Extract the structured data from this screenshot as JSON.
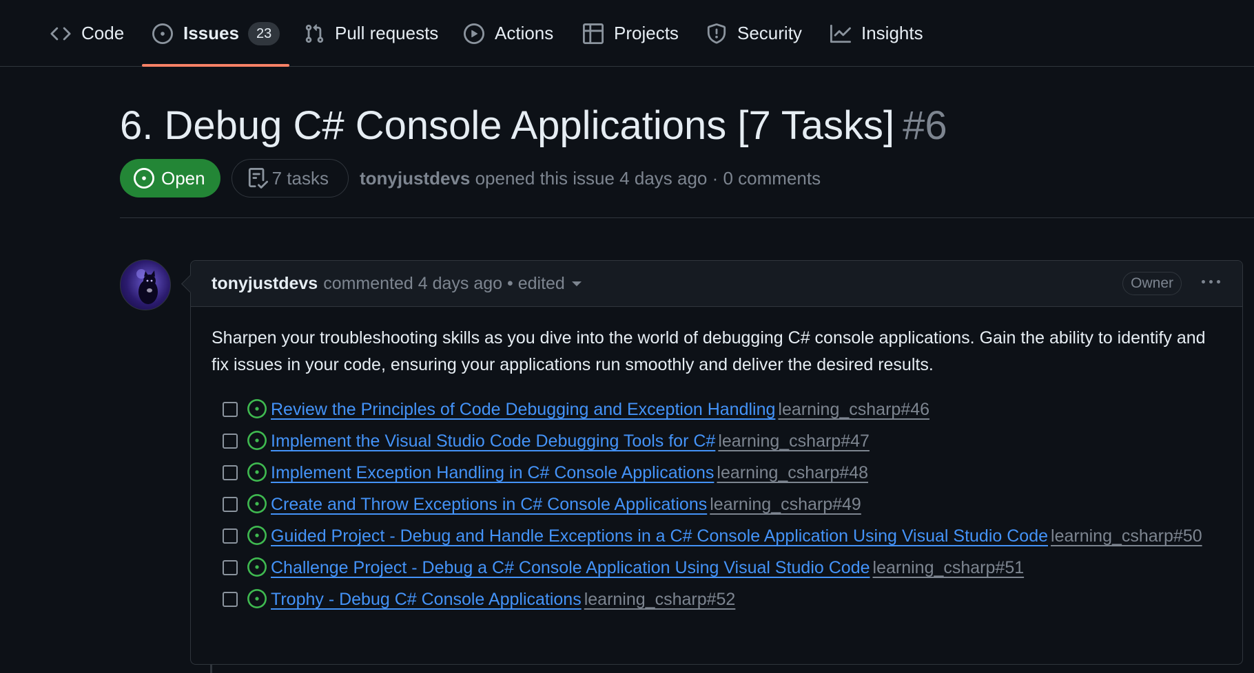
{
  "nav": {
    "tabs": [
      {
        "label": "Code",
        "icon": "code-icon"
      },
      {
        "label": "Issues",
        "icon": "issue-opened-icon",
        "count": "23",
        "selected": true
      },
      {
        "label": "Pull requests",
        "icon": "git-pull-request-icon"
      },
      {
        "label": "Actions",
        "icon": "play-icon"
      },
      {
        "label": "Projects",
        "icon": "table-icon"
      },
      {
        "label": "Security",
        "icon": "shield-icon"
      },
      {
        "label": "Insights",
        "icon": "graph-icon"
      }
    ]
  },
  "issue": {
    "title": "6. Debug C# Console Applications [7 Tasks]",
    "number": "#6",
    "state": "Open",
    "tasks_label": "7 tasks",
    "author": "tonyjustdevs",
    "opened_text": "opened this issue 4 days ago · 0 comments"
  },
  "comment": {
    "author": "tonyjustdevs",
    "meta": "commented 4 days ago • edited",
    "badge": "Owner",
    "description": "Sharpen your troubleshooting skills as you dive into the world of debugging C# console applications. Gain the ability to identify and fix issues in your code, ensuring your applications run smoothly and deliver the desired results.",
    "tasks": [
      {
        "title": "Review the Principles of Code Debugging and Exception Handling",
        "ref": "learning_csharp#46"
      },
      {
        "title": "Implement the Visual Studio Code Debugging Tools for C#",
        "ref": "learning_csharp#47"
      },
      {
        "title": "Implement Exception Handling in C# Console Applications",
        "ref": "learning_csharp#48"
      },
      {
        "title": "Create and Throw Exceptions in C# Console Applications",
        "ref": "learning_csharp#49"
      },
      {
        "title": "Guided Project - Debug and Handle Exceptions in a C# Console Application Using Visual Studio Code",
        "ref": "learning_csharp#50"
      },
      {
        "title": "Challenge Project - Debug a C# Console Application Using Visual Studio Code",
        "ref": "learning_csharp#51"
      },
      {
        "title": "Trophy - Debug C# Console Applications",
        "ref": "learning_csharp#52"
      }
    ]
  },
  "colors": {
    "background": "#0d1117",
    "open_green": "#238636",
    "link_blue": "#4493f8",
    "selected_underline": "#f78166",
    "muted_text": "#7d8590"
  }
}
